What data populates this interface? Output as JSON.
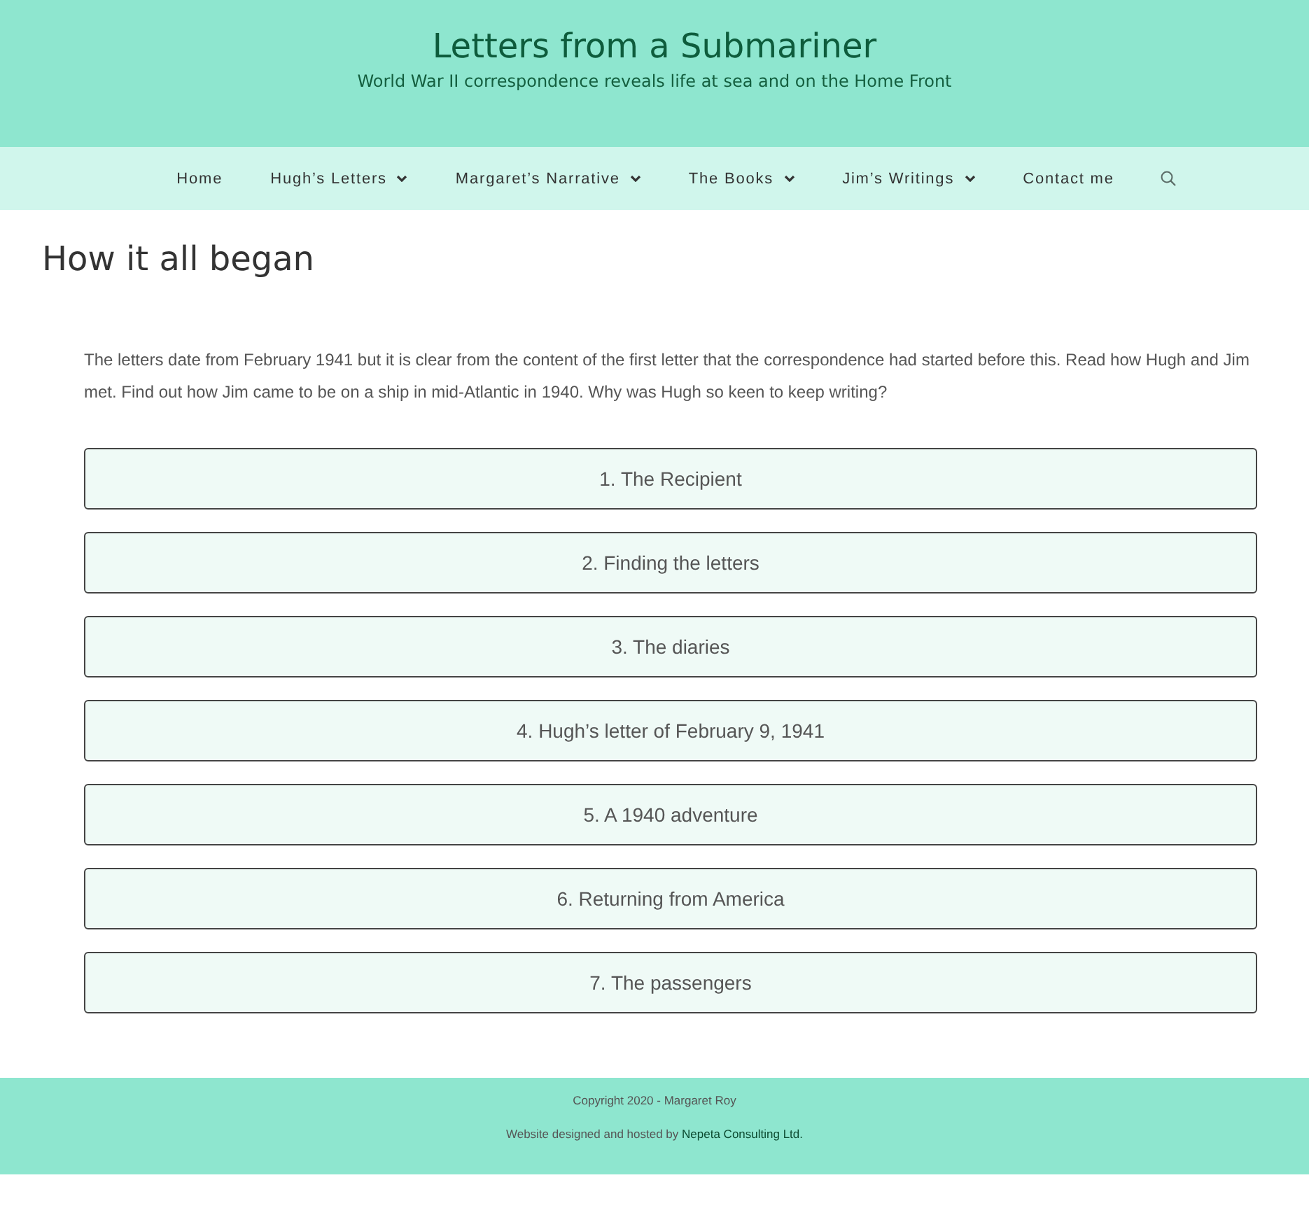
{
  "site": {
    "title": "Letters from a Submariner",
    "tagline": "World War II correspondence reveals life at sea and on the Home Front"
  },
  "nav": {
    "items": [
      {
        "label": "Home",
        "dropdown": false
      },
      {
        "label": "Hugh’s Letters",
        "dropdown": true
      },
      {
        "label": "Margaret’s Narrative",
        "dropdown": true
      },
      {
        "label": "The Books",
        "dropdown": true
      },
      {
        "label": "Jim’s Writings",
        "dropdown": true
      },
      {
        "label": "Contact me",
        "dropdown": false
      }
    ]
  },
  "page": {
    "heading": "How it all began",
    "intro": "The letters date from February 1941 but it is clear from the content of the first letter that the correspondence had started before this. Read how Hugh and Jim met. Find out how Jim came to be on a ship in mid-Atlantic in 1940. Why was Hugh so keen to keep writing?",
    "sections": [
      {
        "label": "1. The Recipient"
      },
      {
        "label": "2. Finding the letters"
      },
      {
        "label": "3. The diaries"
      },
      {
        "label": "4. Hugh’s letter of February 9, 1941"
      },
      {
        "label": "5. A 1940 adventure"
      },
      {
        "label": "6. Returning from America"
      },
      {
        "label": "7. The passengers"
      }
    ]
  },
  "footer": {
    "copyright": "Copyright 2020 - Margaret Roy",
    "credit": "Website designed and hosted by",
    "credit_link": "Nepeta Consulting Ltd."
  }
}
